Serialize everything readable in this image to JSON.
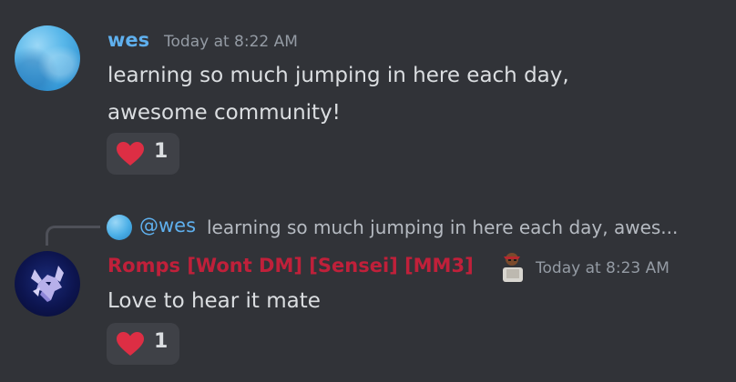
{
  "messages": [
    {
      "author": "wes",
      "author_color": "#5fb0ee",
      "timestamp": "Today at 8:22 AM",
      "lines": [
        "learning so much jumping in here each day,",
        "awesome community!"
      ],
      "reaction": {
        "emoji": "heart-icon",
        "count": "1"
      }
    },
    {
      "reply": {
        "mention": "@wes",
        "preview": "learning so much jumping in here each day, awes..."
      },
      "author": "Romps [Wont DM] [Sensei] [MM3]",
      "author_color": "#c0203a",
      "timestamp": "Today at 8:23 AM",
      "lines": [
        "Love to hear it mate"
      ],
      "reaction": {
        "emoji": "heart-icon",
        "count": "1"
      }
    }
  ]
}
